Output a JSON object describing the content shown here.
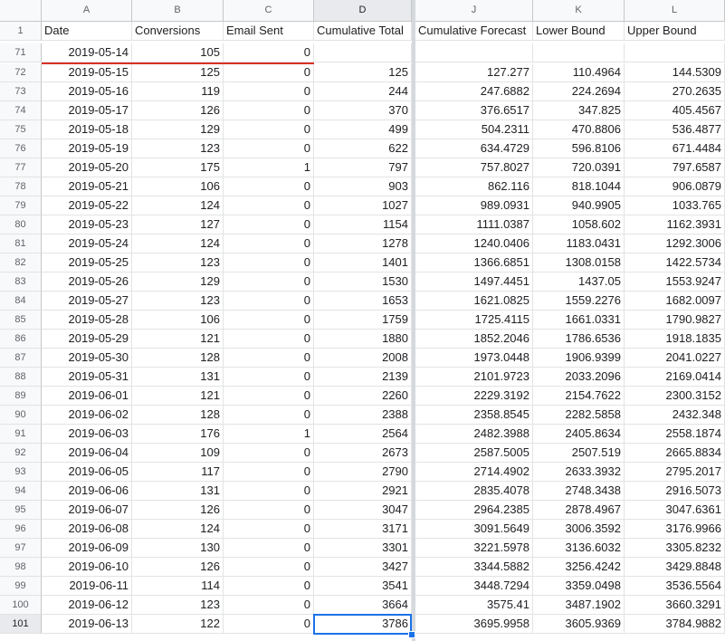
{
  "columns": [
    {
      "letter": "A",
      "header": "Date"
    },
    {
      "letter": "B",
      "header": "Conversions"
    },
    {
      "letter": "C",
      "header": "Email Sent"
    },
    {
      "letter": "D",
      "header": "Cumulative Total"
    },
    {
      "letter": "J",
      "header": "Cumulative Forecast"
    },
    {
      "letter": "K",
      "header": "Lower Bound"
    },
    {
      "letter": "L",
      "header": "Upper Bound"
    }
  ],
  "header_row_number": "1",
  "selected_column": "D",
  "selected_row": "101",
  "rows": [
    {
      "n": "71",
      "a": "2019-05-14",
      "b": "105",
      "c": "0",
      "d": "",
      "j": "",
      "k": "",
      "l": ""
    },
    {
      "n": "72",
      "a": "2019-05-15",
      "b": "125",
      "c": "0",
      "d": "125",
      "j": "127.277",
      "k": "110.4964",
      "l": "144.5309"
    },
    {
      "n": "73",
      "a": "2019-05-16",
      "b": "119",
      "c": "0",
      "d": "244",
      "j": "247.6882",
      "k": "224.2694",
      "l": "270.2635"
    },
    {
      "n": "74",
      "a": "2019-05-17",
      "b": "126",
      "c": "0",
      "d": "370",
      "j": "376.6517",
      "k": "347.825",
      "l": "405.4567"
    },
    {
      "n": "75",
      "a": "2019-05-18",
      "b": "129",
      "c": "0",
      "d": "499",
      "j": "504.2311",
      "k": "470.8806",
      "l": "536.4877"
    },
    {
      "n": "76",
      "a": "2019-05-19",
      "b": "123",
      "c": "0",
      "d": "622",
      "j": "634.4729",
      "k": "596.8106",
      "l": "671.4484"
    },
    {
      "n": "77",
      "a": "2019-05-20",
      "b": "175",
      "c": "1",
      "d": "797",
      "j": "757.8027",
      "k": "720.0391",
      "l": "797.6587"
    },
    {
      "n": "78",
      "a": "2019-05-21",
      "b": "106",
      "c": "0",
      "d": "903",
      "j": "862.116",
      "k": "818.1044",
      "l": "906.0879"
    },
    {
      "n": "79",
      "a": "2019-05-22",
      "b": "124",
      "c": "0",
      "d": "1027",
      "j": "989.0931",
      "k": "940.9905",
      "l": "1033.765"
    },
    {
      "n": "80",
      "a": "2019-05-23",
      "b": "127",
      "c": "0",
      "d": "1154",
      "j": "1111.0387",
      "k": "1058.602",
      "l": "1162.3931"
    },
    {
      "n": "81",
      "a": "2019-05-24",
      "b": "124",
      "c": "0",
      "d": "1278",
      "j": "1240.0406",
      "k": "1183.0431",
      "l": "1292.3006"
    },
    {
      "n": "82",
      "a": "2019-05-25",
      "b": "123",
      "c": "0",
      "d": "1401",
      "j": "1366.6851",
      "k": "1308.0158",
      "l": "1422.5734"
    },
    {
      "n": "83",
      "a": "2019-05-26",
      "b": "129",
      "c": "0",
      "d": "1530",
      "j": "1497.4451",
      "k": "1437.05",
      "l": "1553.9247"
    },
    {
      "n": "84",
      "a": "2019-05-27",
      "b": "123",
      "c": "0",
      "d": "1653",
      "j": "1621.0825",
      "k": "1559.2276",
      "l": "1682.0097"
    },
    {
      "n": "85",
      "a": "2019-05-28",
      "b": "106",
      "c": "0",
      "d": "1759",
      "j": "1725.4115",
      "k": "1661.0331",
      "l": "1790.9827"
    },
    {
      "n": "86",
      "a": "2019-05-29",
      "b": "121",
      "c": "0",
      "d": "1880",
      "j": "1852.2046",
      "k": "1786.6536",
      "l": "1918.1835"
    },
    {
      "n": "87",
      "a": "2019-05-30",
      "b": "128",
      "c": "0",
      "d": "2008",
      "j": "1973.0448",
      "k": "1906.9399",
      "l": "2041.0227"
    },
    {
      "n": "88",
      "a": "2019-05-31",
      "b": "131",
      "c": "0",
      "d": "2139",
      "j": "2101.9723",
      "k": "2033.2096",
      "l": "2169.0414"
    },
    {
      "n": "89",
      "a": "2019-06-01",
      "b": "121",
      "c": "0",
      "d": "2260",
      "j": "2229.3192",
      "k": "2154.7622",
      "l": "2300.3152"
    },
    {
      "n": "90",
      "a": "2019-06-02",
      "b": "128",
      "c": "0",
      "d": "2388",
      "j": "2358.8545",
      "k": "2282.5858",
      "l": "2432.348"
    },
    {
      "n": "91",
      "a": "2019-06-03",
      "b": "176",
      "c": "1",
      "d": "2564",
      "j": "2482.3988",
      "k": "2405.8634",
      "l": "2558.1874"
    },
    {
      "n": "92",
      "a": "2019-06-04",
      "b": "109",
      "c": "0",
      "d": "2673",
      "j": "2587.5005",
      "k": "2507.519",
      "l": "2665.8834"
    },
    {
      "n": "93",
      "a": "2019-06-05",
      "b": "117",
      "c": "0",
      "d": "2790",
      "j": "2714.4902",
      "k": "2633.3932",
      "l": "2795.2017"
    },
    {
      "n": "94",
      "a": "2019-06-06",
      "b": "131",
      "c": "0",
      "d": "2921",
      "j": "2835.4078",
      "k": "2748.3438",
      "l": "2916.5073"
    },
    {
      "n": "95",
      "a": "2019-06-07",
      "b": "126",
      "c": "0",
      "d": "3047",
      "j": "2964.2385",
      "k": "2878.4967",
      "l": "3047.6361"
    },
    {
      "n": "96",
      "a": "2019-06-08",
      "b": "124",
      "c": "0",
      "d": "3171",
      "j": "3091.5649",
      "k": "3006.3592",
      "l": "3176.9966"
    },
    {
      "n": "97",
      "a": "2019-06-09",
      "b": "130",
      "c": "0",
      "d": "3301",
      "j": "3221.5978",
      "k": "3136.6032",
      "l": "3305.8232"
    },
    {
      "n": "98",
      "a": "2019-06-10",
      "b": "126",
      "c": "0",
      "d": "3427",
      "j": "3344.5882",
      "k": "3256.4242",
      "l": "3429.8848"
    },
    {
      "n": "99",
      "a": "2019-06-11",
      "b": "114",
      "c": "0",
      "d": "3541",
      "j": "3448.7294",
      "k": "3359.0498",
      "l": "3536.5564"
    },
    {
      "n": "100",
      "a": "2019-06-12",
      "b": "123",
      "c": "0",
      "d": "3664",
      "j": "3575.41",
      "k": "3487.1902",
      "l": "3660.3291"
    },
    {
      "n": "101",
      "a": "2019-06-13",
      "b": "122",
      "c": "0",
      "d": "3786",
      "j": "3695.9958",
      "k": "3605.9369",
      "l": "3784.9882"
    }
  ]
}
